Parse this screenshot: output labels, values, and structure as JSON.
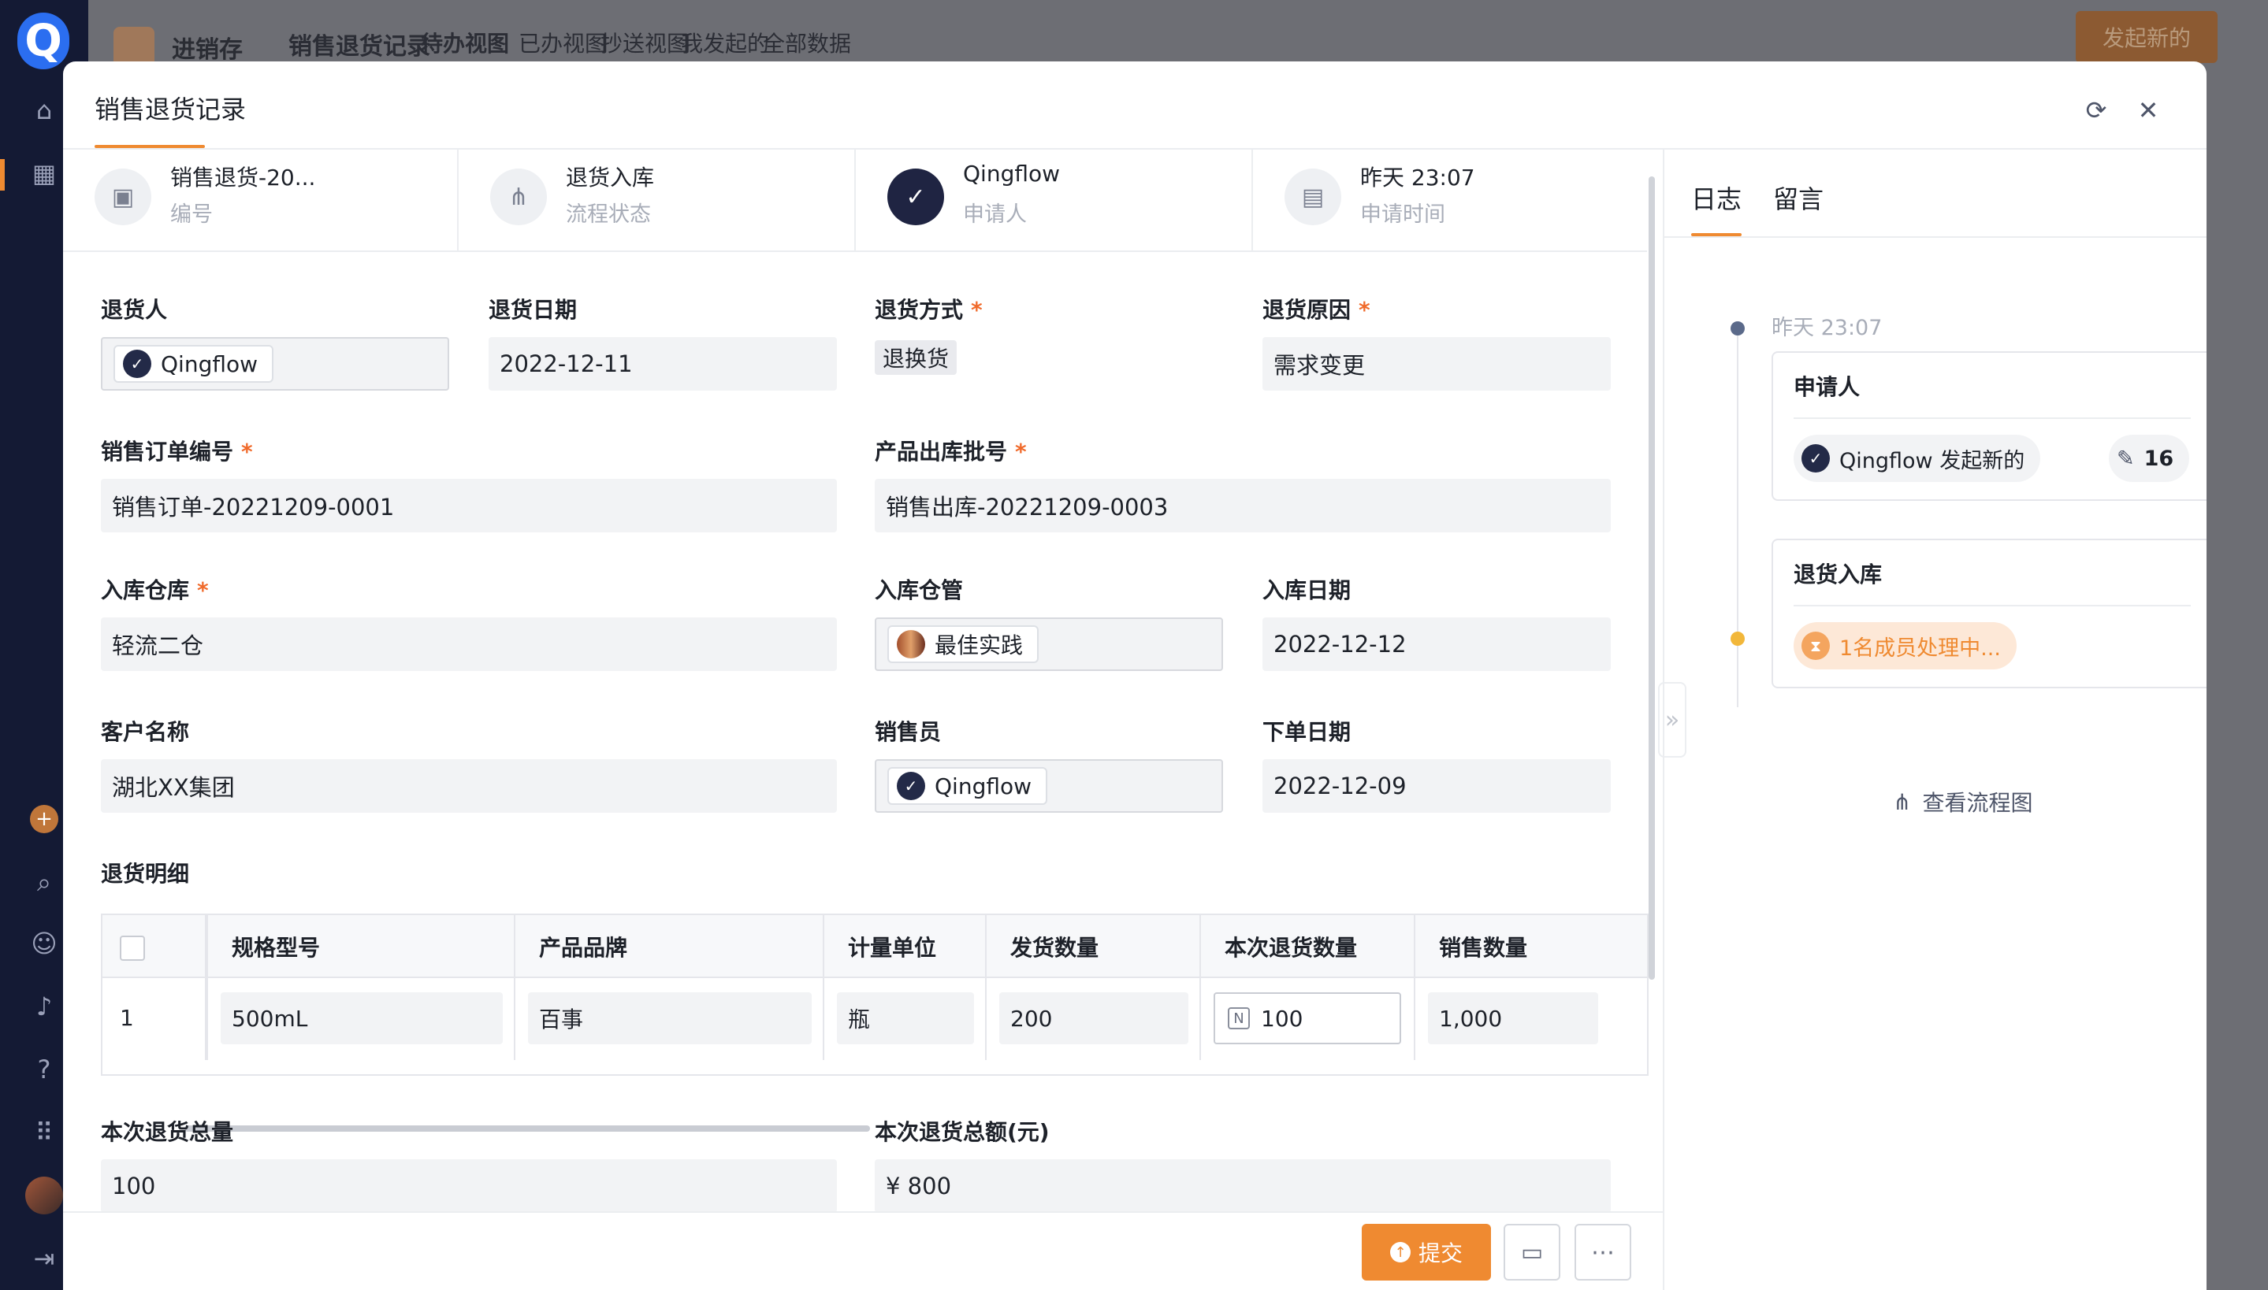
{
  "app": {
    "logo": "Q",
    "name": "进销存",
    "form_name": "销售退货记录",
    "views": [
      "待办视图",
      "已办视图",
      "抄送视图",
      "我发起的",
      "全部数据"
    ],
    "new_button": "发起新的"
  },
  "modal": {
    "title": "销售退货记录",
    "info": [
      {
        "main": "销售退货-20...",
        "sub": "编号",
        "icon": "document-icon"
      },
      {
        "main": "退货入库",
        "sub": "流程状态",
        "icon": "flow-icon"
      },
      {
        "main": "Qingflow",
        "sub": "申请人",
        "icon": "qingflow-avatar"
      },
      {
        "main": "昨天 23:07",
        "sub": "申请时间",
        "icon": "calendar-icon"
      }
    ],
    "fields": {
      "returner": {
        "label": "退货人",
        "value": "Qingflow"
      },
      "return_date": {
        "label": "退货日期",
        "value": "2022-12-11"
      },
      "return_method": {
        "label": "退货方式",
        "value": "退换货"
      },
      "return_reason": {
        "label": "退货原因",
        "value": "需求变更"
      },
      "sales_order": {
        "label": "销售订单编号",
        "value": "销售订单-20221209-0001"
      },
      "batch_no": {
        "label": "产品出库批号",
        "value": "销售出库-20221209-0003"
      },
      "warehouse": {
        "label": "入库仓库",
        "value": "轻流二仓"
      },
      "keeper": {
        "label": "入库仓管",
        "value": "最佳实践"
      },
      "in_date": {
        "label": "入库日期",
        "value": "2022-12-12"
      },
      "customer": {
        "label": "客户名称",
        "value": "湖北XX集团"
      },
      "salesperson": {
        "label": "销售员",
        "value": "Qingflow"
      },
      "order_date": {
        "label": "下单日期",
        "value": "2022-12-09"
      },
      "total_qty": {
        "label": "本次退货总量",
        "value": "100"
      },
      "total_amount": {
        "label": "本次退货总额(元)",
        "value": "¥ 800"
      }
    },
    "detail": {
      "label": "退货明细",
      "columns": [
        "规格型号",
        "产品品牌",
        "计量单位",
        "发货数量",
        "本次退货数量",
        "销售数量"
      ],
      "rows": [
        {
          "index": "1",
          "spec": "500mL",
          "brand": "百事",
          "unit": "瓶",
          "shipped": "200",
          "return_qty": "100",
          "sold": "1,000"
        }
      ]
    },
    "footer": {
      "submit": "提交"
    }
  },
  "panel": {
    "tabs": [
      "日志",
      "留言"
    ],
    "timeline": [
      {
        "time": "昨天 23:07",
        "title": "申请人",
        "pill": "Qingflow 发起新的",
        "badge": "16"
      },
      {
        "title": "退货入库",
        "pill": "1名成员处理中..."
      }
    ],
    "flow_link": "查看流程图"
  },
  "colors": {
    "accent": "#ef8a31",
    "required": "#f06a2b",
    "sidebar": "#141a34"
  }
}
